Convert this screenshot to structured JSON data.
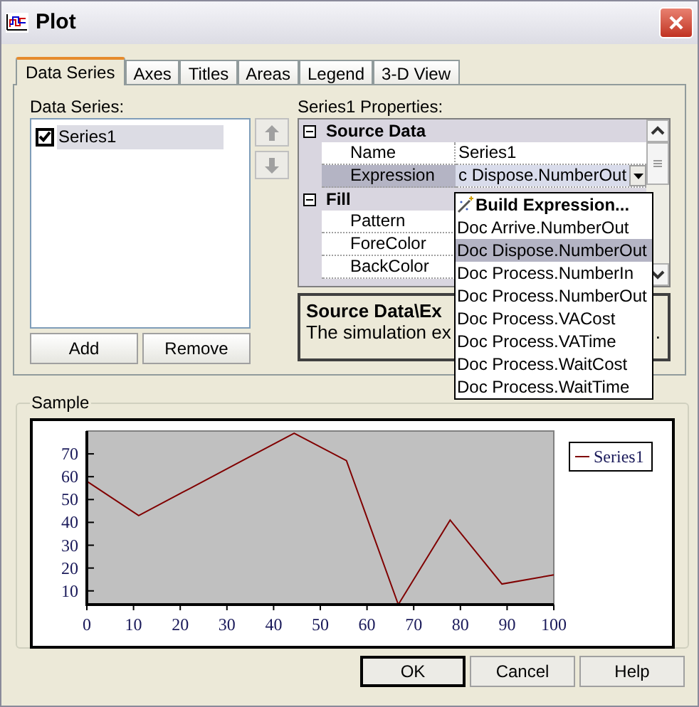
{
  "window": {
    "title": "Plot"
  },
  "tabs": [
    {
      "label": "Data Series",
      "selected": true
    },
    {
      "label": "Axes",
      "selected": false
    },
    {
      "label": "Titles",
      "selected": false
    },
    {
      "label": "Areas",
      "selected": false
    },
    {
      "label": "Legend",
      "selected": false
    },
    {
      "label": "3-D View",
      "selected": false
    }
  ],
  "data_series": {
    "label": "Data Series:",
    "items": [
      {
        "label": "Series1",
        "checked": true,
        "selected": true
      }
    ],
    "buttons": [
      "Add",
      "Remove"
    ]
  },
  "properties": {
    "label": "Series1 Properties:",
    "rows": [
      {
        "kind": "category",
        "label": "Source Data",
        "expanded": true
      },
      {
        "kind": "property",
        "name": "Name",
        "value": "Series1",
        "selected": false
      },
      {
        "kind": "property",
        "name": "Expression",
        "value": "c Dispose.NumberOut",
        "selected": true
      },
      {
        "kind": "category",
        "label": "Fill",
        "expanded": true
      },
      {
        "kind": "property",
        "name": "Pattern",
        "selected": false
      },
      {
        "kind": "property",
        "name": "ForeColor",
        "selected": false
      },
      {
        "kind": "property",
        "name": "BackColor",
        "selected": false
      }
    ],
    "description": {
      "title": "Source Data\\Ex",
      "text": "The simulation ex",
      "text_end": "."
    }
  },
  "dropdown": {
    "items": [
      {
        "kind": "command",
        "label": "Build Expression...",
        "selected": false
      },
      {
        "kind": "option",
        "label": "Doc Arrive.NumberOut",
        "selected": false
      },
      {
        "kind": "option",
        "label": "Doc Dispose.NumberOut",
        "selected": true
      },
      {
        "kind": "option",
        "label": "Doc Process.NumberIn",
        "selected": false
      },
      {
        "kind": "option",
        "label": "Doc Process.NumberOut",
        "selected": false
      },
      {
        "kind": "option",
        "label": "Doc Process.VACost",
        "selected": false
      },
      {
        "kind": "option",
        "label": "Doc Process.VATime",
        "selected": false
      },
      {
        "kind": "option",
        "label": "Doc Process.WaitCost",
        "selected": false
      },
      {
        "kind": "option",
        "label": "Doc Process.WaitTime",
        "selected": false
      }
    ]
  },
  "sample": {
    "label": "Sample",
    "chart_data": {
      "type": "line",
      "x": [
        0,
        11.1,
        22.2,
        33.3,
        44.4,
        55.6,
        66.7,
        77.8,
        88.9,
        100
      ],
      "series": [
        {
          "name": "Series1",
          "color": "#800000",
          "values": [
            58,
            43,
            55,
            67,
            79,
            67,
            4,
            41,
            13,
            17
          ]
        }
      ],
      "xlim": [
        0,
        100
      ],
      "ylim": [
        4,
        80
      ],
      "xticks": [
        0,
        10,
        20,
        30,
        40,
        50,
        60,
        70,
        80,
        90,
        100
      ],
      "yticks": [
        10,
        20,
        30,
        40,
        50,
        60,
        70
      ]
    }
  },
  "buttons": [
    {
      "label": "OK",
      "default": true
    },
    {
      "label": "Cancel",
      "default": false
    },
    {
      "label": "Help",
      "default": false
    }
  ]
}
